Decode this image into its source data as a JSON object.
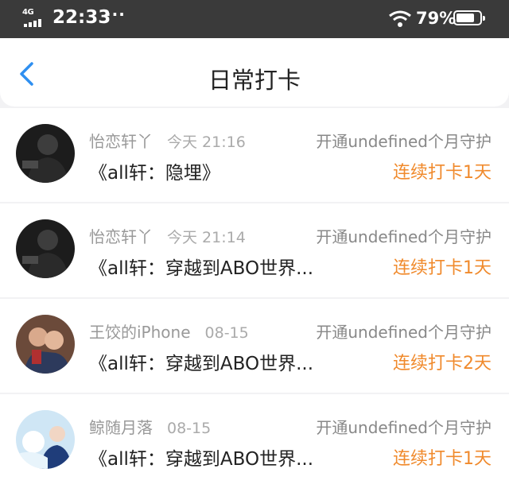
{
  "status_bar": {
    "network": "4G",
    "time": "22:33",
    "more": "···",
    "battery_percent": "79%",
    "battery_level": 0.79
  },
  "header": {
    "title": "日常打卡",
    "back_icon": "chevron-left-icon",
    "accent_color": "#2f8ff0"
  },
  "colors": {
    "streak": "#f08a2c"
  },
  "entries": [
    {
      "name": "怡恋轩丫",
      "time": "今天 21:16",
      "guard": "开通undefined个月守护",
      "book": "《all轩：隐埋》",
      "streak": "连续打卡1天"
    },
    {
      "name": "怡恋轩丫",
      "time": "今天 21:14",
      "guard": "开通undefined个月守护",
      "book": "《all轩：穿越到ABO世界...",
      "streak": "连续打卡1天"
    },
    {
      "name": "王饺的iPhone",
      "time": "08-15",
      "guard": "开通undefined个月守护",
      "book": "《all轩：穿越到ABO世界...",
      "streak": "连续打卡2天"
    },
    {
      "name": "鲸随月落",
      "time": "08-15",
      "guard": "开通undefined个月守护",
      "book": "《all轩：穿越到ABO世界...",
      "streak": "连续打卡1天"
    }
  ]
}
